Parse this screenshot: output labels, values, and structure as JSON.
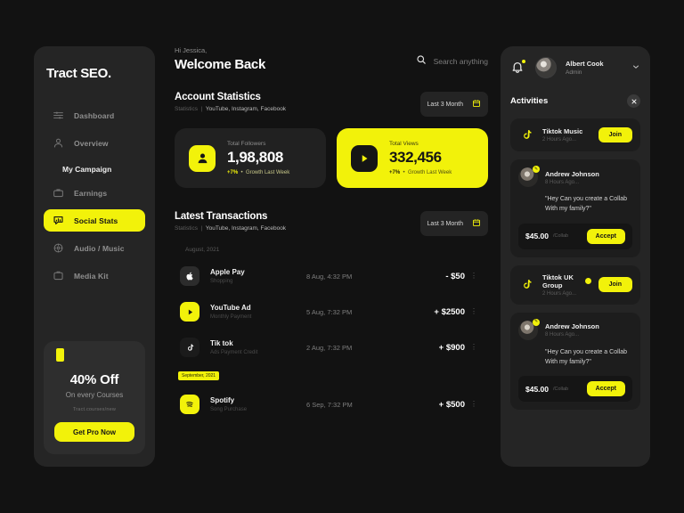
{
  "brand": "Tract SEO.",
  "sidebar": {
    "items": [
      {
        "label": "Dashboard",
        "icon": "sliders-icon",
        "active": false
      },
      {
        "label": "Overview",
        "icon": "user-icon",
        "active": false
      }
    ],
    "section_label": "My Campaign",
    "campaign_items": [
      {
        "label": "Earnings",
        "icon": "briefcase-icon",
        "active": false
      },
      {
        "label": "Social Stats",
        "icon": "chat-stats-icon",
        "active": true
      },
      {
        "label": "Audio / Music",
        "icon": "audio-icon",
        "active": false
      },
      {
        "label": "Media Kit",
        "icon": "media-kit-icon",
        "active": false
      }
    ],
    "promo": {
      "title": "40% Off",
      "subtitle": "On every Courses",
      "link": "Tract.courses/new",
      "button": "Get Pro Now"
    }
  },
  "header": {
    "greeting": "Hi Jessica,",
    "title": "Welcome Back",
    "search_placeholder": "Search anything",
    "search_icon": "search-icon"
  },
  "account_statistics": {
    "title": "Account Statistics",
    "sub_prefix": "Statistics",
    "sub_sources": "YouTube, Instagram, Facebook",
    "filter_label": "Last 3 Month",
    "filter_icon": "calendar-icon",
    "cards": [
      {
        "label": "Total Followers",
        "value": "1,98,808",
        "growth_pct": "+7%",
        "growth_text": "Growth Last Week",
        "icon": "person-icon",
        "accent": false
      },
      {
        "label": "Total Views",
        "value": "332,456",
        "growth_pct": "+7%",
        "growth_text": "Growth Last Week",
        "icon": "play-icon",
        "accent": true
      }
    ]
  },
  "latest_transactions": {
    "title": "Latest Transactions",
    "sub_prefix": "Statistics",
    "sub_sources": "YouTube, Instagram, Facebook",
    "filter_label": "Last 3 Month",
    "filter_icon": "calendar-icon",
    "group_august": "August, 2021",
    "group_september": "September, 2021",
    "rows": [
      {
        "name": "Apple Pay",
        "sub": "Shopping",
        "date": "8 Aug, 4:32 PM",
        "amount": "- $50",
        "icon": "apple-icon",
        "icon_bg": "#2c2c2c",
        "icon_fg": "#ffffff"
      },
      {
        "name": "YouTube Ad",
        "sub": "Monthly Payment",
        "date": "5 Aug, 7:32 PM",
        "amount": "+ $2500",
        "icon": "play-icon",
        "icon_bg": "#F2F20A",
        "icon_fg": "#151515"
      },
      {
        "name": "Tik tok",
        "sub": "Ads Payment Credit",
        "date": "2 Aug, 7:32 PM",
        "amount": "+ $900",
        "icon": "tiktok-icon",
        "icon_bg": "#1b1b1b",
        "icon_fg": "#ffffff"
      },
      {
        "name": "Spotify",
        "sub": "Song Purchase",
        "date": "6 Sep, 7:32 PM",
        "amount": "+ $500",
        "icon": "spotify-icon",
        "icon_bg": "#F2F20A",
        "icon_fg": "#151515"
      }
    ],
    "more_icon": "more-vertical-icon"
  },
  "right_panel": {
    "bell_icon": "bell-icon",
    "user_name": "Albert Cook",
    "user_role": "Admin",
    "chevron_icon": "chevron-down-icon",
    "activities_title": "Activities",
    "close_icon": "close-icon",
    "cards": [
      {
        "type": "join",
        "name": "Tiktok Music",
        "time": "2 Hours Ago...",
        "button": "Join",
        "icon": "tiktok-icon",
        "verified": false
      },
      {
        "type": "request",
        "name": "Andrew Johnson",
        "time": "8 Hours Ago...",
        "message": "\"Hey Can you create a Collab With my family?\"",
        "price": "$45.00",
        "price_unit": "/Collab",
        "button": "Accept",
        "icon": "avatar",
        "badge_icon": "edit-badge-icon"
      },
      {
        "type": "join",
        "name": "Tiktok UK Group",
        "time": "2 Hours Ago...",
        "button": "Join",
        "icon": "tiktok-icon",
        "verified": true
      },
      {
        "type": "request",
        "name": "Andrew Johnson",
        "time": "8 Hours Ago...",
        "message": "\"Hey Can you create a Collab With my family?\"",
        "price": "$45.00",
        "price_unit": "/Collab",
        "button": "Accept",
        "icon": "avatar",
        "badge_icon": "edit-badge-icon"
      }
    ]
  },
  "colors": {
    "accent": "#F2F20A",
    "page_bg": "#121212",
    "panel_bg": "#252525",
    "card_bg": "#1d1d1d"
  }
}
